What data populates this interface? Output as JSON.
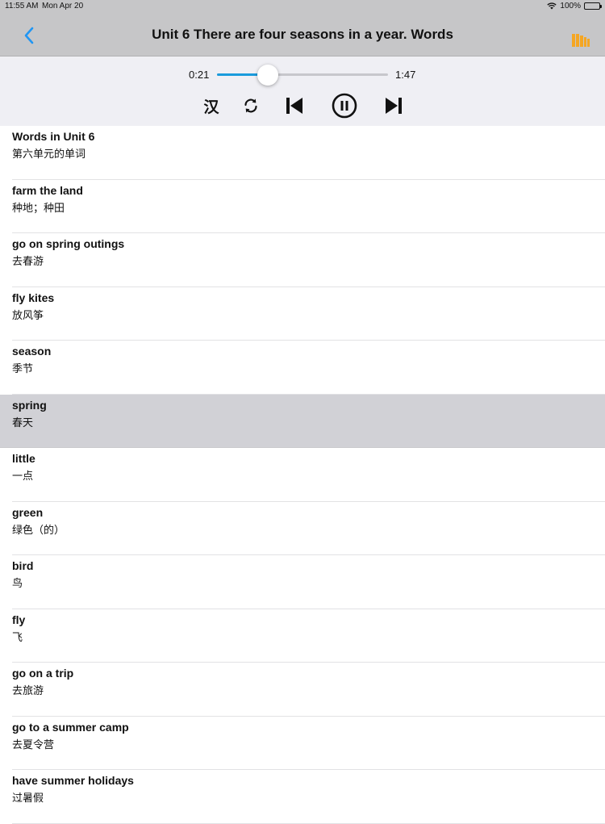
{
  "status_bar": {
    "time": "11:55 AM",
    "date": "Mon Apr 20",
    "battery": "100%"
  },
  "nav": {
    "title": "Unit 6 There are four seasons in a year. Words",
    "back_icon": "chevron-left-icon",
    "library_icon": "books-icon",
    "accent_color": "#2196f3",
    "library_color": "#f5a623"
  },
  "player": {
    "current_time": "0:21",
    "total_time": "1:47",
    "progress": 0.2,
    "chinese_toggle_label": "汉",
    "progress_color": "#1a9bdc"
  },
  "words": [
    {
      "en": "Words in Unit 6",
      "zh": "第六单元的单词"
    },
    {
      "en": "farm the land",
      "zh": "种地；种田"
    },
    {
      "en": "go on spring outings",
      "zh": "去春游"
    },
    {
      "en": "fly kites",
      "zh": "放风筝"
    },
    {
      "en": "season",
      "zh": "季节"
    },
    {
      "en": "spring",
      "zh": "春天",
      "selected": true
    },
    {
      "en": "little",
      "zh": "一点"
    },
    {
      "en": "green",
      "zh": "绿色（的）"
    },
    {
      "en": "bird",
      "zh": "鸟"
    },
    {
      "en": "fly",
      "zh": "飞"
    },
    {
      "en": "go on a trip",
      "zh": "去旅游"
    },
    {
      "en": "go to a summer camp",
      "zh": "去夏令营"
    },
    {
      "en": "have summer holidays",
      "zh": "过暑假"
    }
  ]
}
